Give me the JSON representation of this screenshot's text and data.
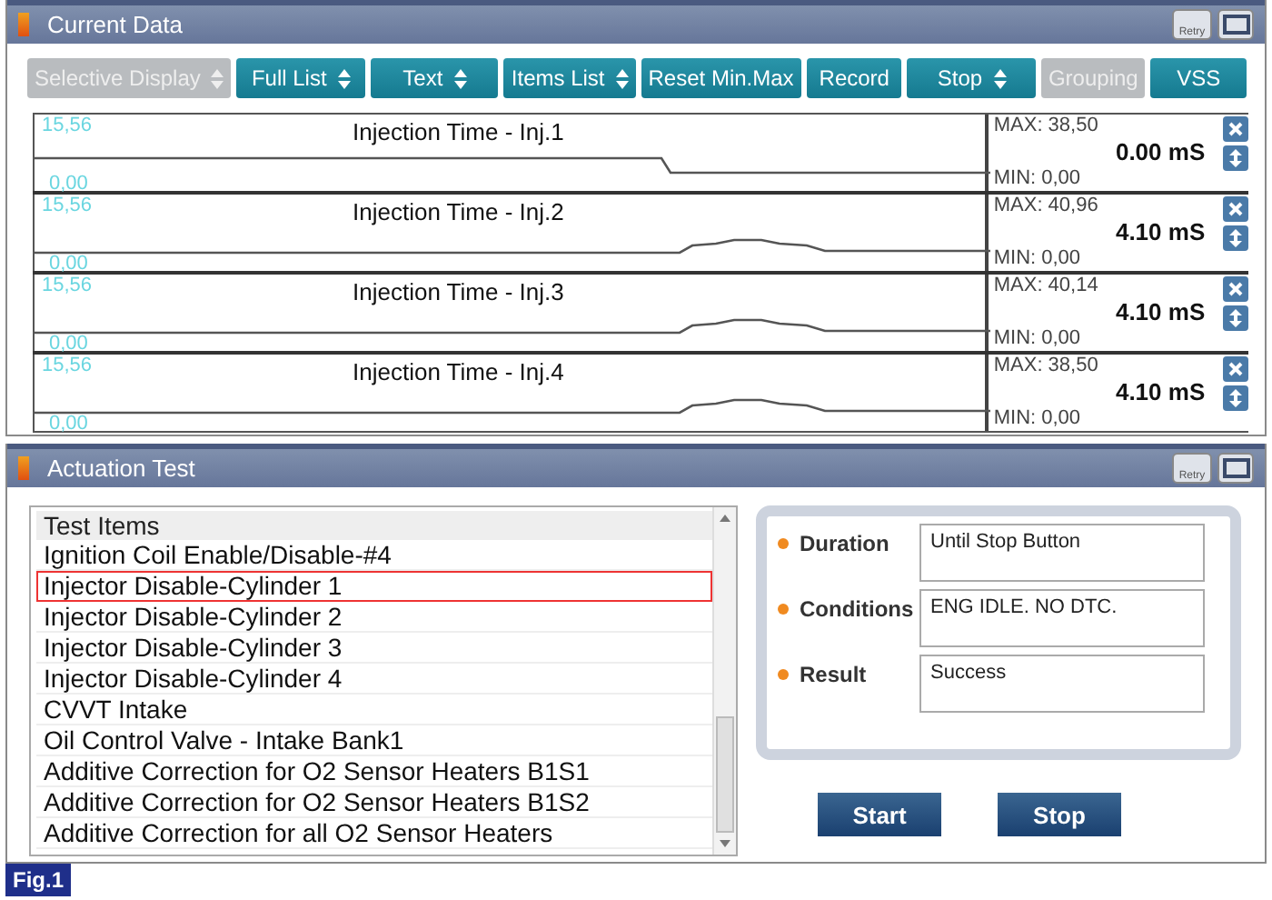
{
  "current_data": {
    "title": "Current Data",
    "retry_label": "Retry",
    "toolbar": [
      {
        "label": "Selective Display",
        "disabled": true,
        "dropdown": true
      },
      {
        "label": "Full List",
        "disabled": false,
        "dropdown": true
      },
      {
        "label": "Text",
        "disabled": false,
        "dropdown": true
      },
      {
        "label": "Items List",
        "disabled": false,
        "dropdown": true
      },
      {
        "label": "Reset Min.Max",
        "disabled": false,
        "dropdown": false
      },
      {
        "label": "Record",
        "disabled": false,
        "dropdown": false
      },
      {
        "label": "Stop",
        "disabled": false,
        "dropdown": true
      },
      {
        "label": "Grouping",
        "disabled": true,
        "dropdown": false
      },
      {
        "label": "VSS",
        "disabled": false,
        "dropdown": false
      }
    ],
    "graphs": [
      {
        "name": "Injection Time - Inj.1",
        "axis_max": "15,56",
        "axis_min": "0,00",
        "max": "MAX: 38,50",
        "value": "0.00 mS",
        "min": "MIN: 0,00",
        "kind": "step"
      },
      {
        "name": "Injection Time - Inj.2",
        "axis_max": "15,56",
        "axis_min": "0,00",
        "max": "MAX: 40,96",
        "value": "4.10 mS",
        "min": "MIN: 0,00",
        "kind": "bump"
      },
      {
        "name": "Injection Time - Inj.3",
        "axis_max": "15,56",
        "axis_min": "0,00",
        "max": "MAX: 40,14",
        "value": "4.10 mS",
        "min": "MIN: 0,00",
        "kind": "bump"
      },
      {
        "name": "Injection Time - Inj.4",
        "axis_max": "15,56",
        "axis_min": "0,00",
        "max": "MAX: 38,50",
        "value": "4.10 mS",
        "min": "MIN: 0,00",
        "kind": "bump"
      }
    ]
  },
  "actuation_test": {
    "title": "Actuation Test",
    "retry_label": "Retry",
    "list_header": "Test Items",
    "items": [
      {
        "label": "Ignition Coil Enable/Disable-#4",
        "selected": false
      },
      {
        "label": "Injector Disable-Cylinder 1",
        "selected": true
      },
      {
        "label": "Injector Disable-Cylinder 2",
        "selected": false
      },
      {
        "label": "Injector Disable-Cylinder 3",
        "selected": false
      },
      {
        "label": "Injector Disable-Cylinder 4",
        "selected": false
      },
      {
        "label": "CVVT Intake",
        "selected": false
      },
      {
        "label": "Oil Control Valve - Intake Bank1",
        "selected": false
      },
      {
        "label": "Additive Correction for O2 Sensor Heaters B1S1",
        "selected": false
      },
      {
        "label": "Additive Correction for O2 Sensor Heaters B1S2",
        "selected": false
      },
      {
        "label": "Additive Correction for all O2 Sensor Heaters",
        "selected": false
      }
    ],
    "details": [
      {
        "label": "Duration",
        "value": "Until Stop Button"
      },
      {
        "label": "Conditions",
        "value": "ENG IDLE. NO DTC."
      },
      {
        "label": "Result",
        "value": "Success"
      }
    ],
    "buttons": [
      "Start",
      "Stop"
    ]
  },
  "figure_label": "Fig.1"
}
